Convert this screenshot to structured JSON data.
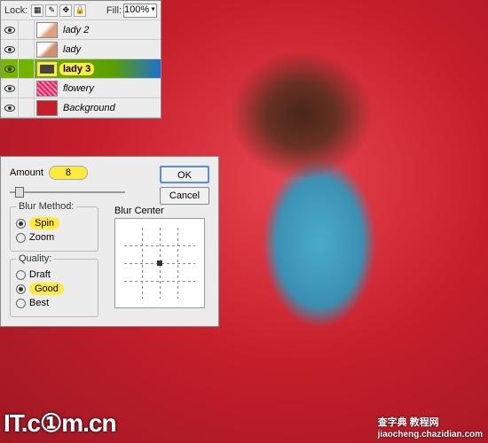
{
  "layers_panel": {
    "lock_label": "Lock:",
    "fill_label": "Fill:",
    "fill_value": "100%",
    "layers": [
      {
        "name": "lady 2",
        "thumb": "lady2"
      },
      {
        "name": "lady",
        "thumb": "lady"
      },
      {
        "name": "lady 3",
        "thumb": "lady3",
        "selected": true
      },
      {
        "name": "flowery",
        "thumb": "flowery"
      },
      {
        "name": "Background",
        "thumb": "bg"
      }
    ]
  },
  "dialog": {
    "amount_label": "Amount",
    "amount_value": "8",
    "ok": "OK",
    "cancel": "Cancel",
    "blur_method": {
      "title": "Blur Method:",
      "options": [
        {
          "label": "Spin",
          "checked": true,
          "highlight": true
        },
        {
          "label": "Zoom",
          "checked": false
        }
      ]
    },
    "quality": {
      "title": "Quality:",
      "options": [
        {
          "label": "Draft",
          "checked": false
        },
        {
          "label": "Good",
          "checked": true,
          "highlight": true
        },
        {
          "label": "Best",
          "checked": false
        }
      ]
    },
    "blur_center_label": "Blur Center"
  },
  "watermarks": {
    "left": "IT.c①m.cn",
    "right_main": "查字典 教程网",
    "right_sub": "jiaocheng.chazidian.com"
  }
}
